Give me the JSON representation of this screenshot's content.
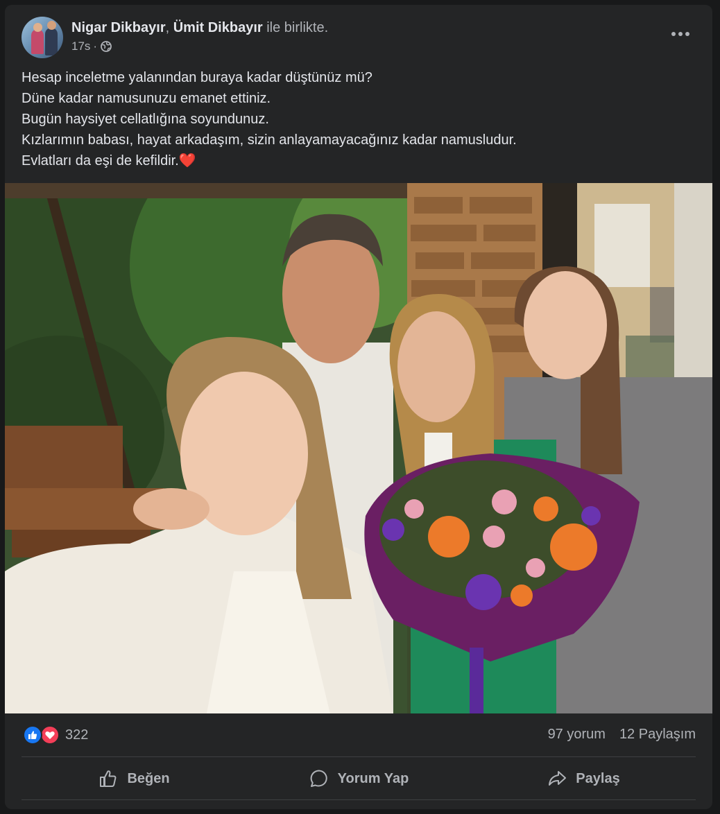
{
  "post": {
    "author_1": "Nigar Dikbayır",
    "separator": ", ",
    "author_2": "Ümit Dikbayır",
    "with_text": " ile birlikte.",
    "time": "17s",
    "time_sep": "·",
    "privacy_icon": "globe-icon",
    "more_icon": "more-options-icon",
    "text_lines": [
      "Hesap inceletme yalanından buraya kadar düştünüz mü?",
      "Düne kadar namusunuzu emanet ettiniz.",
      "Bugün haysiyet cellatlığına soyundunuz.",
      "Kızlarımın babası, hayat arkadaşım, sizin anlayamayacağınız kadar namusludur.",
      "Evlatları da eşi de kefildir."
    ],
    "text_emoji": "❤️"
  },
  "stats": {
    "reaction_icons": [
      "like-reaction-icon",
      "love-reaction-icon"
    ],
    "reaction_count": "322",
    "comments": "97 yorum",
    "shares": "12 Paylaşım"
  },
  "actions": {
    "like_label": "Beğen",
    "comment_label": "Yorum Yap",
    "share_label": "Paylaş"
  },
  "colors": {
    "background": "#18191a",
    "card": "#242526",
    "text_primary": "#e4e6eb",
    "text_secondary": "#b0b3b8",
    "like_blue": "#1877f2",
    "love_red": "#f33e58"
  }
}
